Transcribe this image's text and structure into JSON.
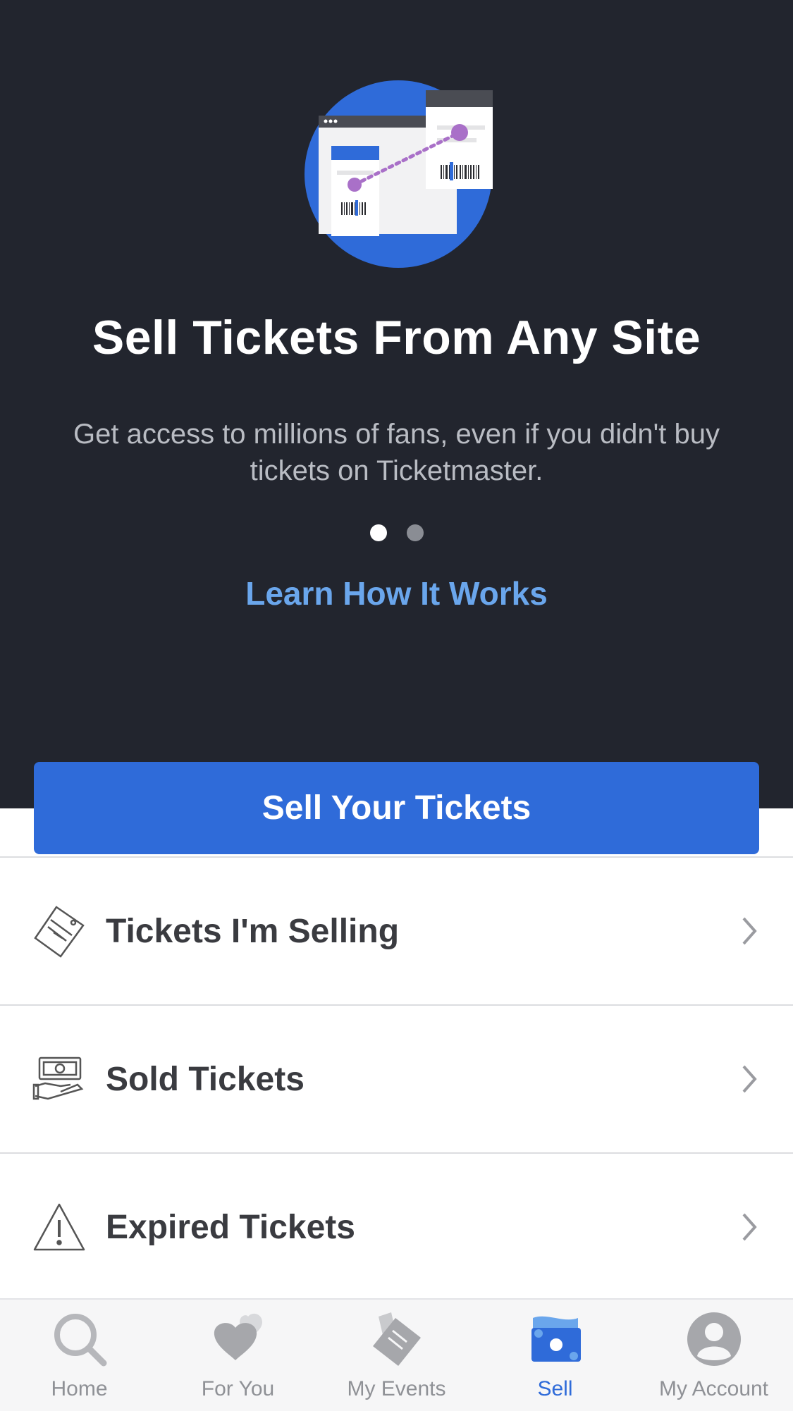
{
  "hero": {
    "title": "Sell Tickets From Any Site",
    "subtitle": "Get access to millions of fans, even if you didn't buy tickets on Ticketmaster.",
    "pager": {
      "count": 2,
      "active_index": 0
    },
    "link_label": "Learn How It Works"
  },
  "primary_action": {
    "label": "Sell Your Tickets"
  },
  "menu": {
    "items": [
      {
        "label": "Tickets I'm Selling",
        "icon": "ticket-tag-icon"
      },
      {
        "label": "Sold Tickets",
        "icon": "cash-hand-icon"
      },
      {
        "label": "Expired Tickets",
        "icon": "warning-triangle-icon"
      }
    ]
  },
  "tabbar": {
    "tabs": [
      {
        "label": "Home",
        "icon": "search-icon",
        "active": false
      },
      {
        "label": "For You",
        "icon": "hearts-icon",
        "active": false
      },
      {
        "label": "My Events",
        "icon": "tickets-icon",
        "active": false
      },
      {
        "label": "Sell",
        "icon": "money-icon",
        "active": true
      },
      {
        "label": "My Account",
        "icon": "person-icon",
        "active": false
      }
    ]
  },
  "colors": {
    "hero_background": "#22252e",
    "accent_blue": "#2f6bd9",
    "link_blue": "#6aa6ec",
    "illustration_purple": "#a970c8"
  }
}
